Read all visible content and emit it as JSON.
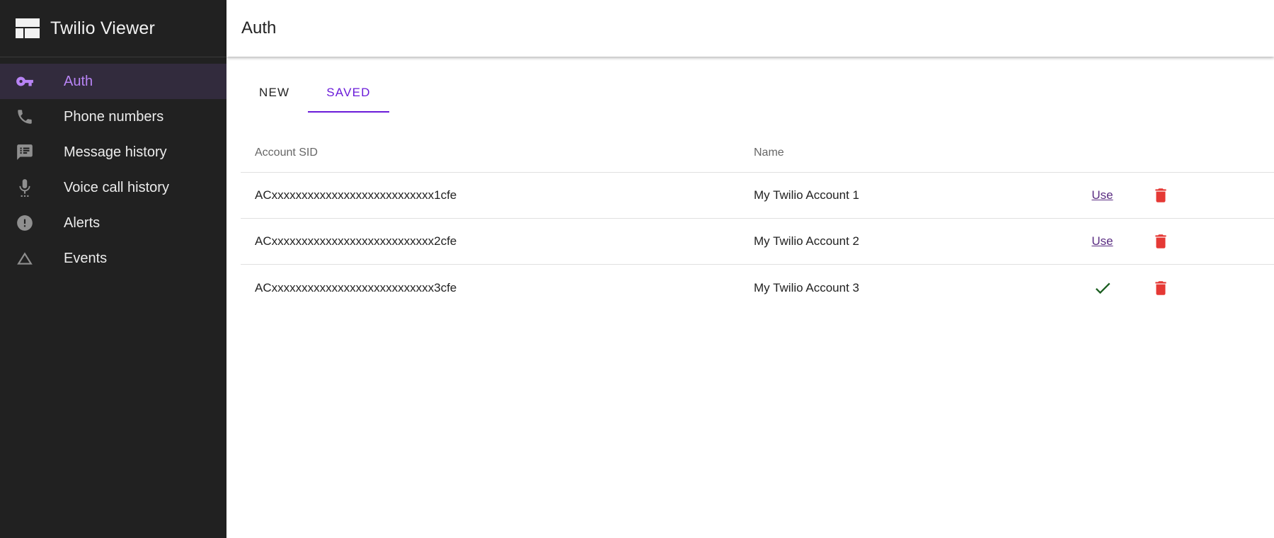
{
  "app": {
    "title": "Twilio Viewer",
    "accent_color": "#b884f5",
    "tab_accent_color": "#6a1bd9",
    "delete_color": "#e53935",
    "check_color": "#1b5e20"
  },
  "sidebar": {
    "items": [
      {
        "label": "Auth",
        "icon": "key-icon",
        "active": true
      },
      {
        "label": "Phone numbers",
        "icon": "phone-icon",
        "active": false
      },
      {
        "label": "Message history",
        "icon": "message-icon",
        "active": false
      },
      {
        "label": "Voice call history",
        "icon": "microphone-icon",
        "active": false
      },
      {
        "label": "Alerts",
        "icon": "alert-icon",
        "active": false
      },
      {
        "label": "Events",
        "icon": "triangle-icon",
        "active": false
      }
    ]
  },
  "header": {
    "title": "Auth"
  },
  "tabs": [
    {
      "label": "NEW",
      "active": false
    },
    {
      "label": "SAVED",
      "active": true
    }
  ],
  "table": {
    "columns": {
      "sid": "Account SID",
      "name": "Name"
    },
    "rows": [
      {
        "sid": "ACxxxxxxxxxxxxxxxxxxxxxxxxxxx1cfe",
        "name": "My Twilio Account 1",
        "action": "Use",
        "in_use": false
      },
      {
        "sid": "ACxxxxxxxxxxxxxxxxxxxxxxxxxxx2cfe",
        "name": "My Twilio Account 2",
        "action": "Use",
        "in_use": false
      },
      {
        "sid": "ACxxxxxxxxxxxxxxxxxxxxxxxxxxx3cfe",
        "name": "My Twilio Account 3",
        "action": "",
        "in_use": true
      }
    ]
  }
}
